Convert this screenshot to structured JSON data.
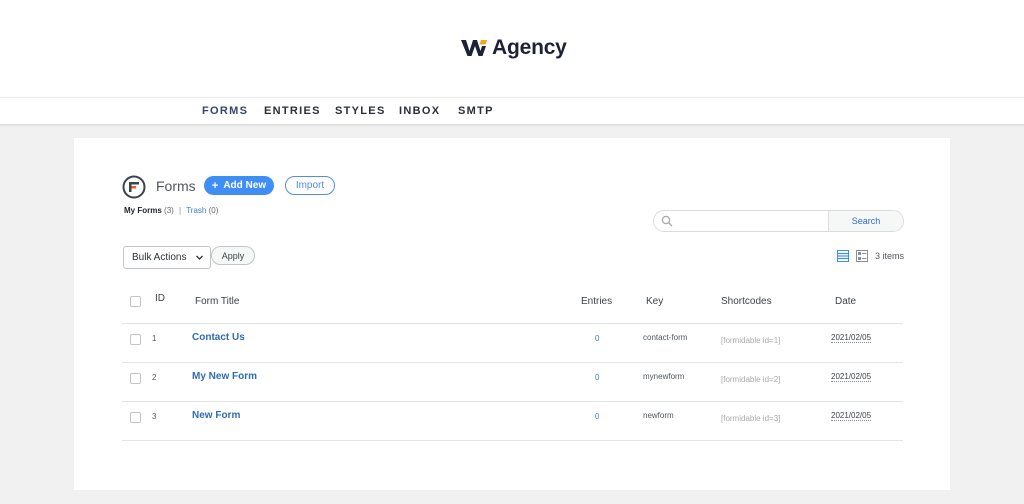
{
  "brand": {
    "name": "Agency",
    "mark_colors": {
      "dark": "#1d2335",
      "accent": "#f2a51f"
    }
  },
  "nav": [
    {
      "label": "FORMS",
      "active": true
    },
    {
      "label": "ENTRIES",
      "active": false
    },
    {
      "label": "STYLES",
      "active": false
    },
    {
      "label": "INBOX",
      "active": false
    },
    {
      "label": "SMTP",
      "active": false
    }
  ],
  "page": {
    "title": "Forms",
    "add_new_label": "Add New",
    "import_label": "Import",
    "filters": {
      "my_forms": "My Forms",
      "my_forms_count": "(3)",
      "separator": "|",
      "trash": "Trash",
      "trash_count": "(0)"
    },
    "search": {
      "placeholder": "",
      "button": "Search"
    },
    "bulk": {
      "selected": "Bulk Actions",
      "apply": "Apply"
    },
    "items_count": "3 items"
  },
  "table": {
    "headers": {
      "id": "ID",
      "title": "Form Title",
      "entries": "Entries",
      "key": "Key",
      "shortcodes": "Shortcodes",
      "date": "Date"
    },
    "rows": [
      {
        "id": "1",
        "title": "Contact Us",
        "entries": "0",
        "key": "contact-form",
        "shortcode": "[formidable id=1]",
        "date": "2021/02/05"
      },
      {
        "id": "2",
        "title": "My New Form",
        "entries": "0",
        "key": "mynewform",
        "shortcode": "[formidable id=2]",
        "date": "2021/02/05"
      },
      {
        "id": "3",
        "title": "New Form",
        "entries": "0",
        "key": "newform",
        "shortcode": "[formidable id=3]",
        "date": "2021/02/05"
      }
    ]
  },
  "colors": {
    "primary": "#3e8ef5",
    "link": "#2f6bb8",
    "nav_active": "#35476e"
  }
}
